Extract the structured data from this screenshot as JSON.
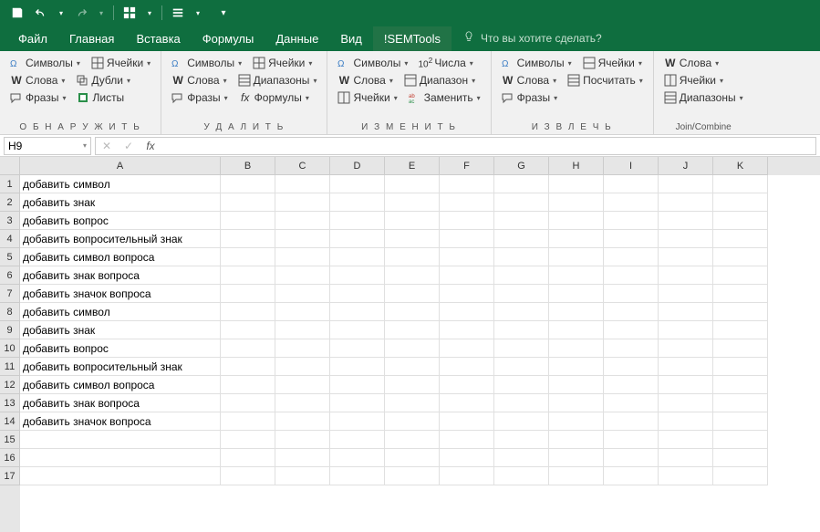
{
  "qat": {
    "save": "save",
    "undo": "undo",
    "redo": "redo"
  },
  "tabs": {
    "file": "Файл",
    "home": "Главная",
    "insert": "Вставка",
    "formulas": "Формулы",
    "data": "Данные",
    "view": "Вид",
    "semtools": "!SEMTools",
    "tellme": "Что вы хотите сделать?"
  },
  "ribbon": {
    "g1": {
      "label": "О Б Н А Р У Ж И Т Ь",
      "symbols": "Символы",
      "cells": "Ячейки",
      "words": "Слова",
      "dubli": "Дубли",
      "phrases": "Фразы",
      "sheets": "Листы"
    },
    "g2": {
      "label": "У Д А Л И Т Ь",
      "symbols": "Символы",
      "cells": "Ячейки",
      "words": "Слова",
      "ranges": "Диапазоны",
      "phrases": "Фразы",
      "formulas": "Формулы"
    },
    "g3": {
      "label": "И З М Е Н И Т Ь",
      "symbols": "Символы",
      "numbers": "Числа",
      "words": "Слова",
      "range": "Диапазон",
      "cells": "Ячейки",
      "replace": "Заменить"
    },
    "g4": {
      "label": "И З В Л Е Ч Ь",
      "symbols": "Символы",
      "cells": "Ячейки",
      "words": "Слова",
      "count": "Посчитать",
      "phrases": "Фразы"
    },
    "g5": {
      "label": "Join/Combine",
      "words": "Слова",
      "cells": "Ячейки",
      "ranges": "Диапазоны"
    }
  },
  "namebox": "H9",
  "columns": [
    "A",
    "B",
    "C",
    "D",
    "E",
    "F",
    "G",
    "H",
    "I",
    "J",
    "K"
  ],
  "rows": [
    "добавить символ",
    "добавить знак",
    "добавить вопрос",
    "добавить вопросительный знак",
    "добавить символ вопроса",
    "добавить знак вопроса",
    "добавить значок вопроса",
    "добавить символ",
    "добавить знак",
    "добавить вопрос",
    "добавить вопросительный знак",
    "добавить символ вопроса",
    "добавить знак вопроса",
    "добавить значок вопроса",
    "",
    "",
    ""
  ]
}
